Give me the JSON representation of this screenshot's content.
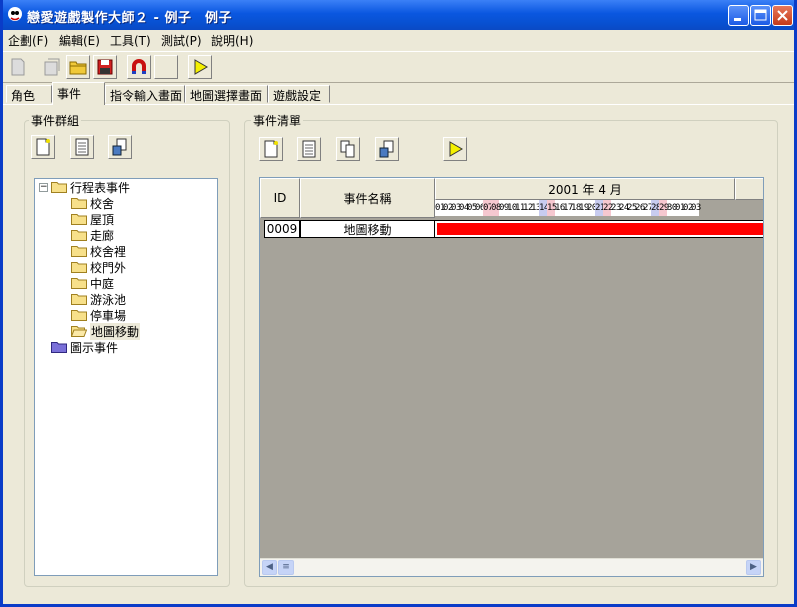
{
  "window": {
    "title": "戀愛遊戲製作大師２ - 例子　例子",
    "colors": {
      "titlebar": "#0a57e0",
      "face": "#ece9d8",
      "bar": "#ff0000"
    }
  },
  "menu": [
    "企劃(F)",
    "編輯(E)",
    "工具(T)",
    "測試(P)",
    "說明(H)"
  ],
  "toolbar": {
    "buttons": [
      "new-doc-icon",
      "open-template-icon",
      "open-folder-icon",
      "save-icon",
      "undo-magnet-icon",
      "blank-icon",
      "play-icon"
    ]
  },
  "tabs": [
    "角色",
    "事件",
    "指令輸入畫面",
    "地圖選擇畫面",
    "遊戲設定"
  ],
  "active_tab": "事件",
  "left_group": {
    "label": "事件群組",
    "tree": {
      "root1": "行程表事件",
      "children": [
        "校舍",
        "屋頂",
        "走廊",
        "校舍裡",
        "校門外",
        "中庭",
        "游泳池",
        "停車場",
        "地圖移動"
      ],
      "root2": "圖示事件"
    }
  },
  "right_group": {
    "label": "事件清單",
    "grid": {
      "col_id": "ID",
      "col_name": "事件名稱",
      "month_header": "2001 年 4 月",
      "days": [
        "01",
        "02",
        "03",
        "04",
        "05",
        "06",
        "07",
        "08",
        "09",
        "10",
        "11",
        "12",
        "13",
        "14",
        "15",
        "16",
        "17",
        "18",
        "19",
        "20",
        "21",
        "22",
        "23",
        "24",
        "25",
        "26",
        "27",
        "28",
        "29",
        "30",
        "01",
        "02",
        "03"
      ],
      "rows": [
        {
          "id": "0009",
          "name": "地圖移動"
        }
      ]
    }
  }
}
